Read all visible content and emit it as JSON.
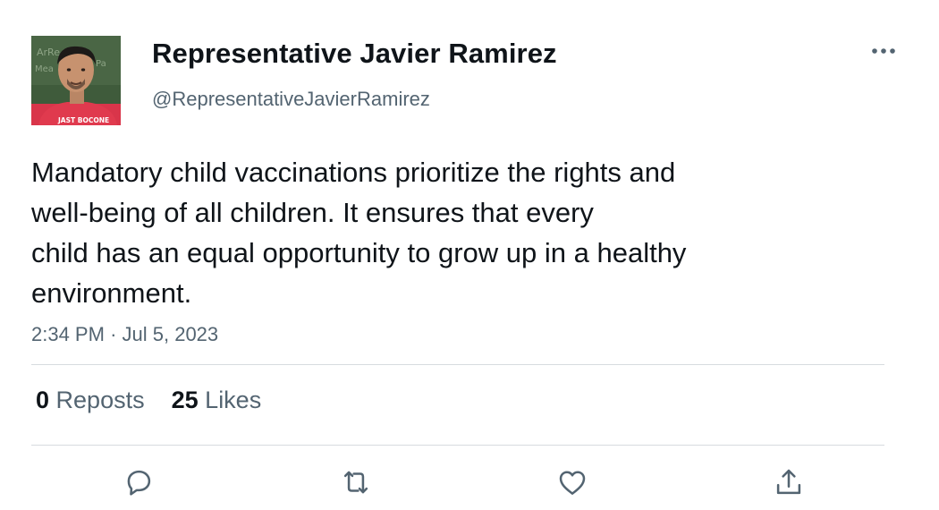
{
  "author": {
    "display_name": "Representative Javier Ramirez",
    "handle": "@RepresentativeJavierRamirez",
    "avatar_icon": "profile-photo",
    "avatar_shirt_text": "JAST BOCONE"
  },
  "tweet": {
    "lines": [
      "Mandatory child vaccinations prioritize the rights and",
      "well-being of all children. It ensures that every",
      "child has an equal opportunity to grow up in a healthy",
      "environment."
    ],
    "time": "2:34 PM",
    "separator": "·",
    "date": "Jul 5, 2023"
  },
  "stats": {
    "reposts_count": "0",
    "reposts_label": "Reposts",
    "likes_count": "25",
    "likes_label": "Likes"
  },
  "actions": {
    "reply_icon": "reply-icon",
    "repost_icon": "repost-icon",
    "like_icon": "heart-icon",
    "share_icon": "share-icon",
    "more_icon": "more-options-icon"
  },
  "colors": {
    "text_primary": "#0f1419",
    "text_secondary": "#536471",
    "divider": "#d7dbdf",
    "icon": "#536471"
  }
}
